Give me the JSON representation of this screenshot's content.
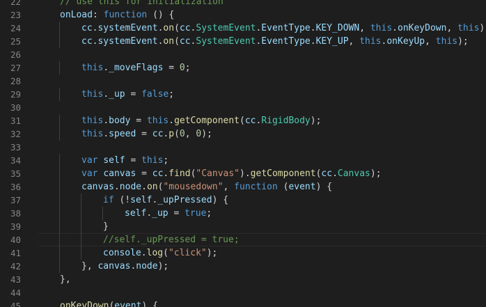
{
  "editor": {
    "first_line_number": 22,
    "current_line": 40,
    "lines": [
      {
        "indent": 1,
        "tokens": [
          [
            "c",
            "// use this for initialization"
          ]
        ]
      },
      {
        "indent": 1,
        "tokens": [
          [
            "v",
            "onLoad"
          ],
          [
            "p",
            ": "
          ],
          [
            "k",
            "function"
          ],
          [
            "p",
            " () {"
          ]
        ]
      },
      {
        "indent": 2,
        "tokens": [
          [
            "v",
            "cc"
          ],
          [
            "p",
            "."
          ],
          [
            "v",
            "systemEvent"
          ],
          [
            "p",
            "."
          ],
          [
            "f",
            "on"
          ],
          [
            "p",
            "("
          ],
          [
            "v",
            "cc"
          ],
          [
            "p",
            "."
          ],
          [
            "t",
            "SystemEvent"
          ],
          [
            "p",
            "."
          ],
          [
            "v",
            "EventType"
          ],
          [
            "p",
            "."
          ],
          [
            "v",
            "KEY_DOWN"
          ],
          [
            "p",
            ", "
          ],
          [
            "k",
            "this"
          ],
          [
            "p",
            "."
          ],
          [
            "v",
            "onKeyDown"
          ],
          [
            "p",
            ", "
          ],
          [
            "k",
            "this"
          ],
          [
            "p",
            ");"
          ]
        ]
      },
      {
        "indent": 2,
        "tokens": [
          [
            "v",
            "cc"
          ],
          [
            "p",
            "."
          ],
          [
            "v",
            "systemEvent"
          ],
          [
            "p",
            "."
          ],
          [
            "f",
            "on"
          ],
          [
            "p",
            "("
          ],
          [
            "v",
            "cc"
          ],
          [
            "p",
            "."
          ],
          [
            "t",
            "SystemEvent"
          ],
          [
            "p",
            "."
          ],
          [
            "v",
            "EventType"
          ],
          [
            "p",
            "."
          ],
          [
            "v",
            "KEY_UP"
          ],
          [
            "p",
            ", "
          ],
          [
            "k",
            "this"
          ],
          [
            "p",
            "."
          ],
          [
            "v",
            "onKeyUp"
          ],
          [
            "p",
            ", "
          ],
          [
            "k",
            "this"
          ],
          [
            "p",
            ");"
          ]
        ]
      },
      {
        "indent": 0,
        "tokens": []
      },
      {
        "indent": 2,
        "tokens": [
          [
            "k",
            "this"
          ],
          [
            "p",
            "."
          ],
          [
            "v",
            "_moveFlags"
          ],
          [
            "p",
            " = "
          ],
          [
            "n",
            "0"
          ],
          [
            "p",
            ";"
          ]
        ]
      },
      {
        "indent": 0,
        "tokens": []
      },
      {
        "indent": 2,
        "tokens": [
          [
            "k",
            "this"
          ],
          [
            "p",
            "."
          ],
          [
            "v",
            "_up"
          ],
          [
            "p",
            " = "
          ],
          [
            "k",
            "false"
          ],
          [
            "p",
            ";"
          ]
        ]
      },
      {
        "indent": 0,
        "tokens": []
      },
      {
        "indent": 2,
        "tokens": [
          [
            "k",
            "this"
          ],
          [
            "p",
            "."
          ],
          [
            "v",
            "body"
          ],
          [
            "p",
            " = "
          ],
          [
            "k",
            "this"
          ],
          [
            "p",
            "."
          ],
          [
            "f",
            "getComponent"
          ],
          [
            "p",
            "("
          ],
          [
            "v",
            "cc"
          ],
          [
            "p",
            "."
          ],
          [
            "t",
            "RigidBody"
          ],
          [
            "p",
            ");"
          ]
        ]
      },
      {
        "indent": 2,
        "tokens": [
          [
            "k",
            "this"
          ],
          [
            "p",
            "."
          ],
          [
            "v",
            "speed"
          ],
          [
            "p",
            " = "
          ],
          [
            "v",
            "cc"
          ],
          [
            "p",
            "."
          ],
          [
            "f",
            "p"
          ],
          [
            "p",
            "("
          ],
          [
            "n",
            "0"
          ],
          [
            "p",
            ", "
          ],
          [
            "n",
            "0"
          ],
          [
            "p",
            ");"
          ]
        ]
      },
      {
        "indent": 0,
        "tokens": []
      },
      {
        "indent": 2,
        "tokens": [
          [
            "k",
            "var"
          ],
          [
            "p",
            " "
          ],
          [
            "v",
            "self"
          ],
          [
            "p",
            " = "
          ],
          [
            "k",
            "this"
          ],
          [
            "p",
            ";"
          ]
        ]
      },
      {
        "indent": 2,
        "tokens": [
          [
            "k",
            "var"
          ],
          [
            "p",
            " "
          ],
          [
            "v",
            "canvas"
          ],
          [
            "p",
            " = "
          ],
          [
            "v",
            "cc"
          ],
          [
            "p",
            "."
          ],
          [
            "f",
            "find"
          ],
          [
            "p",
            "("
          ],
          [
            "s",
            "\"Canvas\""
          ],
          [
            "p",
            ")."
          ],
          [
            "f",
            "getComponent"
          ],
          [
            "p",
            "("
          ],
          [
            "v",
            "cc"
          ],
          [
            "p",
            "."
          ],
          [
            "t",
            "Canvas"
          ],
          [
            "p",
            ");"
          ]
        ]
      },
      {
        "indent": 2,
        "tokens": [
          [
            "v",
            "canvas"
          ],
          [
            "p",
            "."
          ],
          [
            "v",
            "node"
          ],
          [
            "p",
            "."
          ],
          [
            "f",
            "on"
          ],
          [
            "p",
            "("
          ],
          [
            "s",
            "\"mousedown\""
          ],
          [
            "p",
            ", "
          ],
          [
            "k",
            "function"
          ],
          [
            "p",
            " ("
          ],
          [
            "v",
            "event"
          ],
          [
            "p",
            ") {"
          ]
        ]
      },
      {
        "indent": 3,
        "tokens": [
          [
            "k",
            "if"
          ],
          [
            "p",
            " (!"
          ],
          [
            "v",
            "self"
          ],
          [
            "p",
            "."
          ],
          [
            "v",
            "_upPressed"
          ],
          [
            "p",
            ") {"
          ]
        ]
      },
      {
        "indent": 4,
        "tokens": [
          [
            "v",
            "self"
          ],
          [
            "p",
            "."
          ],
          [
            "v",
            "_up"
          ],
          [
            "p",
            " = "
          ],
          [
            "k",
            "true"
          ],
          [
            "p",
            ";"
          ]
        ]
      },
      {
        "indent": 3,
        "tokens": [
          [
            "p",
            "}"
          ]
        ]
      },
      {
        "indent": 3,
        "tokens": [
          [
            "c",
            "//self._upPressed = true;"
          ]
        ]
      },
      {
        "indent": 3,
        "tokens": [
          [
            "v",
            "console"
          ],
          [
            "p",
            "."
          ],
          [
            "f",
            "log"
          ],
          [
            "p",
            "("
          ],
          [
            "s",
            "\"click\""
          ],
          [
            "p",
            ");"
          ]
        ]
      },
      {
        "indent": 2,
        "tokens": [
          [
            "p",
            "}, "
          ],
          [
            "v",
            "canvas"
          ],
          [
            "p",
            "."
          ],
          [
            "v",
            "node"
          ],
          [
            "p",
            ");"
          ]
        ]
      },
      {
        "indent": 1,
        "tokens": [
          [
            "p",
            "},"
          ]
        ]
      },
      {
        "indent": 0,
        "tokens": []
      },
      {
        "indent": 1,
        "tokens": [
          [
            "f",
            "onKeyDown"
          ],
          [
            "p",
            "("
          ],
          [
            "v",
            "event"
          ],
          [
            "p",
            ") {"
          ]
        ]
      }
    ]
  },
  "colors": {
    "background": "#1e1e1e",
    "line_number": "#858585",
    "keyword": "#569cd6",
    "function": "#dcdcaa",
    "variable": "#9cdcfe",
    "string": "#ce9178",
    "number": "#b5cea8",
    "comment": "#6a9955",
    "type": "#4ec9b0",
    "punctuation": "#d4d4d4"
  }
}
